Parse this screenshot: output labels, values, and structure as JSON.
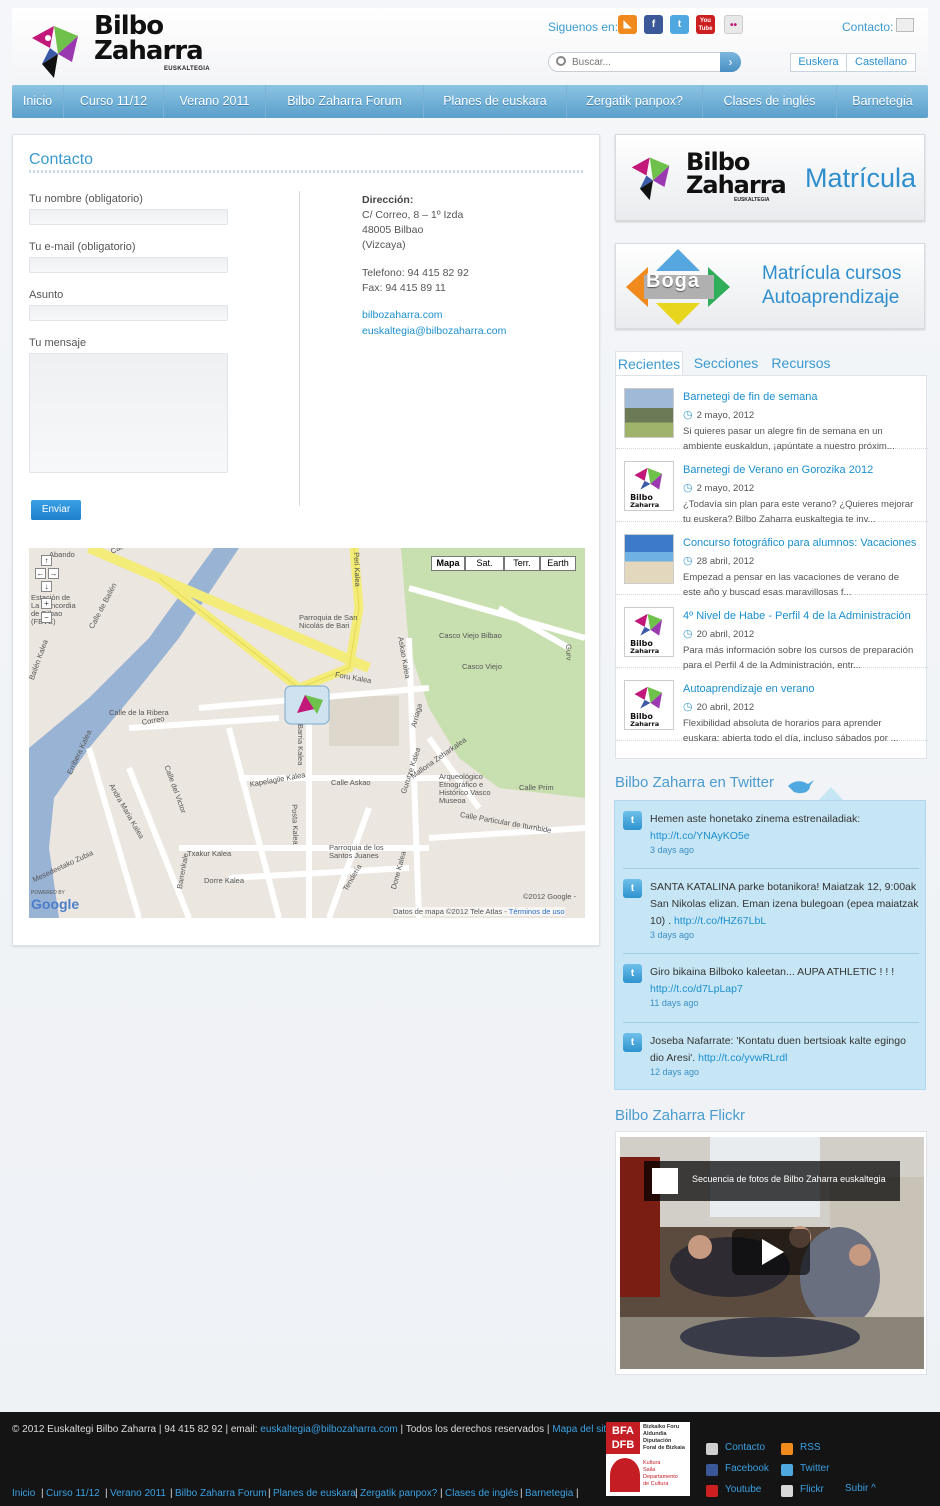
{
  "brand": {
    "logo_line1": "Bilbo",
    "logo_line2": "Zaharra",
    "logo_sub": "EUSKALTEGIA"
  },
  "header": {
    "follow_label": "Siguenos en:",
    "contact_label": "Contacto:",
    "search_placeholder": "Buscar...",
    "social_icons": [
      {
        "name": "rss-icon",
        "glyph": "◣",
        "color": "#f08a1c"
      },
      {
        "name": "facebook-icon",
        "glyph": "f",
        "color": "#3b5998"
      },
      {
        "name": "twitter-icon",
        "glyph": "t",
        "color": "#4fa9e0"
      },
      {
        "name": "youtube-icon",
        "glyph": "You Tube",
        "color": "#cc2020"
      },
      {
        "name": "flickr-icon",
        "glyph": "••",
        "color": "#e8e8e8"
      }
    ],
    "languages": [
      "Euskera",
      "Castellano"
    ]
  },
  "nav": {
    "items": [
      "Inicio",
      "Curso 11/12",
      "Verano 2011",
      "Bilbo Zaharra Forum",
      "Planes de euskara",
      "Zergatik panpox?",
      "Clases de inglés",
      "Barnetegia"
    ]
  },
  "contact": {
    "title": "Contacto",
    "name_label": "Tu nombre (obligatorio)",
    "email_label": "Tu e-mail (obligatorio)",
    "subject_label": "Asunto",
    "message_label": "Tu mensaje",
    "submit_label": "Enviar",
    "address_heading": "Dirección:",
    "address_lines": [
      "C/ Correo, 8 – 1º Izda",
      "48005 Bilbao",
      "(Vizcaya)"
    ],
    "phone": "Telefono: 94 415 82 92",
    "fax": "Fax: 94 415 89 11",
    "web": "bilbozaharra.com",
    "email": "euskaltegia@bilbozaharra.com"
  },
  "map": {
    "types": [
      "Mapa",
      "Sat.",
      "Terr.",
      "Earth"
    ],
    "labels": [
      "Calle Navarra",
      "Abando",
      "Estación de La Concordia de Bilbao (FEVE)",
      "Calle de Bailén",
      "Bailén Kalea",
      "Parroquia de San Nicolás de Bari",
      "Casco Viejo Bilbao",
      "Casco Viejo",
      "Foru Kalea",
      "Askao Kalea",
      "Arriaga",
      "Calle de la Ribera",
      "Correo",
      "Barria Kalea",
      "Calle del Victor",
      "Kapelagile Kalea",
      "Calle Askao",
      "Mallona Zeharkalea",
      "Arqueológico Etnográfico e Histórico Vasco Museoa",
      "Calle Prim",
      "Calle Particular de Iturribide",
      "Erribera Kalea",
      "Andra Maria Kalea",
      "Posta Kalea",
      "Gurutze Kalea",
      "Txakur Kalea",
      "Parroquia de los Santos Juanes",
      "Dorre Kalea",
      "Mesedeetako Zubia",
      "Barrenkale",
      "Tendería",
      "Done Kalea",
      "Peri Kalea",
      "Gurv"
    ],
    "copyright": "©2012 Google -",
    "data_credit": "Datos de mapa ©2012 Tele Atlas -",
    "terms": "Términos de uso",
    "powered": "POWERED BY",
    "google": "Google"
  },
  "banners": {
    "matricula_logo_1": "Bilbo",
    "matricula_logo_2": "Zaharra",
    "matricula_logo_sub": "EUSKALTEGIA",
    "matricula": "Matrícula",
    "boga": "Boga",
    "auto_line1": "Matrícula cursos",
    "auto_line2": "Autoaprendizaje"
  },
  "tabs": [
    "Recientes",
    "Secciones",
    "Recursos"
  ],
  "recent": [
    {
      "title": "Barnetegi de fin de semana",
      "date": "2 mayo, 2012",
      "excerpt": " Si quieres pasar un alegre fin de semana en un ambiente euskaldun, ¡apúntate a nuestro próxim...",
      "thumb": "photo"
    },
    {
      "title": "Barnetegi de Verano en Gorozika 2012",
      "date": "2 mayo, 2012",
      "excerpt": "¿Todavía sin plan para este verano? ¿Quieres mejorar tu euskera? Bilbo Zaharra euskaltegia te inv...",
      "thumb": "logo"
    },
    {
      "title": "Concurso fotográfico para alumnos: Vacaciones",
      "date": "28 abril, 2012",
      "excerpt": " Empezad a pensar en las vacaciones de verano de este año y buscad esas maravillosas f...",
      "thumb": "beach"
    },
    {
      "title": "4º Nivel de Habe - Perfil 4 de la Administración",
      "date": "20 abril, 2012",
      "excerpt": "Para más información sobre los cursos de preparación para el Perfil 4 de la Administración, entr...",
      "thumb": "logo"
    },
    {
      "title": "Autoaprendizaje en verano",
      "date": "20 abril, 2012",
      "excerpt": "Flexibilidad absoluta de horarios para aprender euskara: abierta todo el día, incluso sábados por ...",
      "thumb": "logo"
    }
  ],
  "twitter": {
    "title": "Bilbo Zaharra en Twitter",
    "tweets": [
      {
        "text": "Hemen aste honetako zinema estrenailadiak:",
        "link": "http://t.co/YNAyKO5e",
        "time": "3 days ago"
      },
      {
        "text": "SANTA KATALINA parke botanikora! Maiatzak 12, 9:00ak San Nikolas elizan. Eman izena bulegoan (epea maiatzak 10) .",
        "link": "http://t.co/fHZ67LbL",
        "time": "3 days ago"
      },
      {
        "text": "Giro bikaina Bilboko kaleetan... AUPA ATHLETIC ! ! !",
        "link": "http://t.co/d7LpLap7",
        "time": "11 days ago"
      },
      {
        "text": "Joseba Nafarrate: 'Kontatu duen bertsioak kalte egingo dio Aresi'.",
        "link": "http://t.co/yvwRLrdl",
        "time": "12 days ago"
      }
    ]
  },
  "flickr": {
    "title": "Bilbo Zaharra Flickr",
    "caption": "Secuencia de fotos de Bilbo Zaharra euskaltegia"
  },
  "footer": {
    "copyright": "© 2012 Euskaltegi Bilbo Zaharra | 94 415 82 92 | email:",
    "email": "euskaltegia@bilbozaharra.com",
    "rights": "| Todos los derechos reservados |",
    "sitemap": "Mapa del sitio",
    "nav": [
      "Inicio",
      "Curso 11/12",
      "Verano 2011",
      "Bilbo Zaharra Forum",
      "Planes de euskara",
      "Zergatik panpox?",
      "Clases de inglés",
      "Barnetegia"
    ],
    "bfa_line1": "BFA",
    "bfa_line2": "DFB",
    "bfa_text": [
      "Bizkaiko Foru",
      "Aldundia",
      "Diputación",
      "Foral de Bizkaia"
    ],
    "kultura": [
      "Kultura",
      "Saila",
      "Departamento",
      "de Cultura"
    ],
    "links": [
      {
        "label": "Contacto",
        "icon": "mail-icon",
        "color": "#cfcfcf"
      },
      {
        "label": "RSS",
        "icon": "rss-icon",
        "color": "#f08a1c"
      },
      {
        "label": "Facebook",
        "icon": "facebook-icon",
        "color": "#3b5998"
      },
      {
        "label": "Twitter",
        "icon": "twitter-icon",
        "color": "#4fa9e0"
      },
      {
        "label": "Youtube",
        "icon": "youtube-icon",
        "color": "#cc2020"
      },
      {
        "label": "Flickr",
        "icon": "flickr-icon",
        "color": "#d8d8d8"
      }
    ],
    "up": "Subir ^"
  },
  "colors": {
    "accent": "#3a9ad0",
    "nav": "#6aabd4",
    "link": "#1a8fcf"
  }
}
